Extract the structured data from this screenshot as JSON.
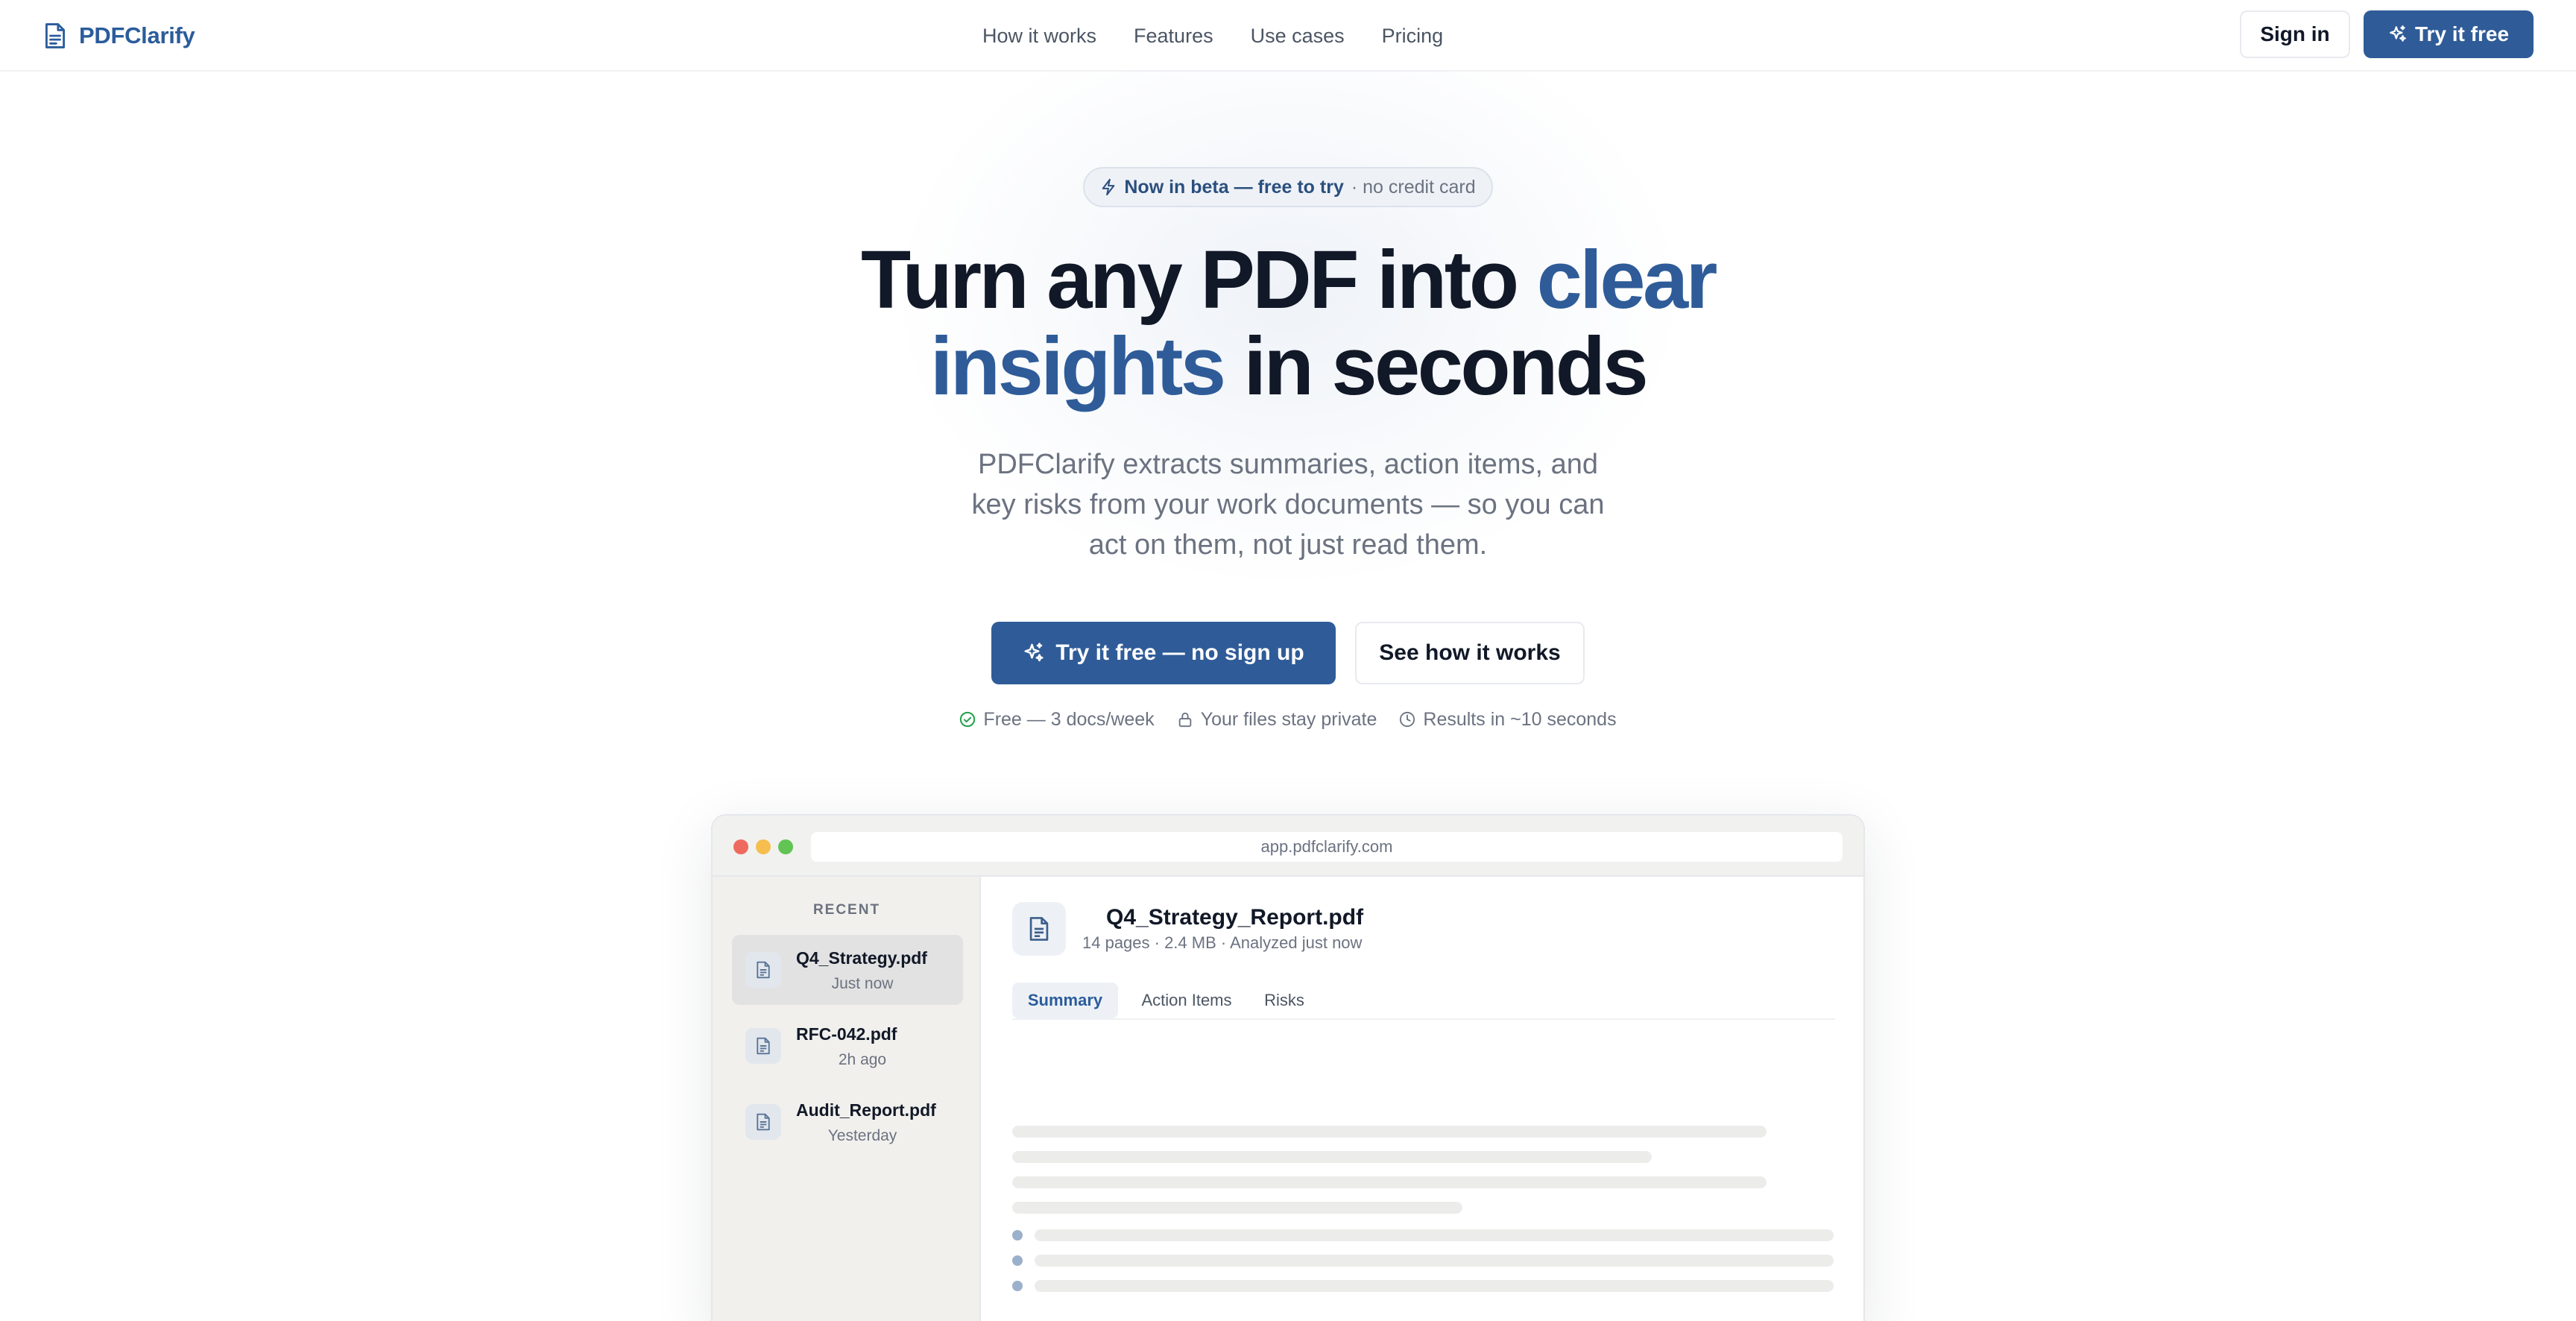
{
  "brand": {
    "name": "PDFClarify",
    "icon": "document-icon"
  },
  "nav": {
    "links": [
      "How it works",
      "Features",
      "Use cases",
      "Pricing"
    ],
    "sign_in": "Sign in",
    "try_free": "Try it free"
  },
  "hero": {
    "badge": {
      "strong": "Now in beta — free to try",
      "light": "· no credit card"
    },
    "headline": {
      "line1_plain": "Turn any PDF into ",
      "line1_accent": "clear",
      "line2_accent": "insights",
      "line2_plain": " in seconds"
    },
    "subhead": "PDFClarify extracts summaries, action items, and key risks from your work documents — so you can act on them, not just read them.",
    "cta_primary": "Try it free — no sign up",
    "cta_secondary": "See how it works",
    "trust": [
      "Free — 3 docs/week",
      "Your files stay private",
      "Results in ~10 seconds"
    ]
  },
  "app_preview": {
    "url": "app.pdfclarify.com",
    "sidebar": {
      "heading": "RECENT",
      "files": [
        {
          "name": "Q4_Strategy.pdf",
          "time": "Just now",
          "active": true
        },
        {
          "name": "RFC-042.pdf",
          "time": "2h ago",
          "active": false
        },
        {
          "name": "Audit_Report.pdf",
          "time": "Yesterday",
          "active": false
        }
      ]
    },
    "document": {
      "title": "Q4_Strategy_Report.pdf",
      "meta": "14 pages · 2.4 MB · Analyzed just now"
    },
    "tabs": [
      "Summary",
      "Action Items",
      "Risks"
    ],
    "active_tab": "Summary"
  },
  "colors": {
    "accent": "#2f5c98",
    "brand_text": "#2b5c9b",
    "success": "#22a04b",
    "mac_red": "#ee6a5f",
    "mac_yellow": "#f5be4f",
    "mac_green": "#62c454"
  }
}
